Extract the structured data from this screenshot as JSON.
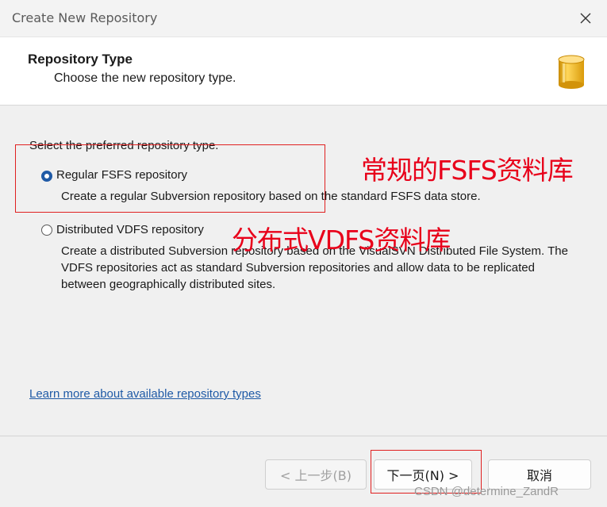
{
  "window": {
    "title": "Create New Repository"
  },
  "header": {
    "title": "Repository Type",
    "subtitle": "Choose the new repository type.",
    "icon": "database-icon"
  },
  "content": {
    "prompt": "Select the preferred repository type.",
    "options": [
      {
        "label": "Regular FSFS repository",
        "description": "Create a regular Subversion repository based on the standard FSFS data store.",
        "selected": true
      },
      {
        "label": "Distributed VDFS repository",
        "description": "Create a distributed Subversion repository based on the VisualSVN Distributed File System. The VDFS repositories act as standard Subversion repositories and allow data to be replicated between geographically distributed sites.",
        "selected": false
      }
    ],
    "learn_more_link": "Learn more about available repository types"
  },
  "annotations": {
    "fsfs": "常规的FSFS资料库",
    "vdfs": "分布式VDFS资料库",
    "color": "#e8001a"
  },
  "footer": {
    "back_label": "< 上一步(B)",
    "next_label": "下一页(N) >",
    "cancel_label": "取消"
  },
  "watermark": "CSDN @determine_ZandR",
  "colors": {
    "accent": "#1f5aa6",
    "annotation_red": "#e02020"
  }
}
